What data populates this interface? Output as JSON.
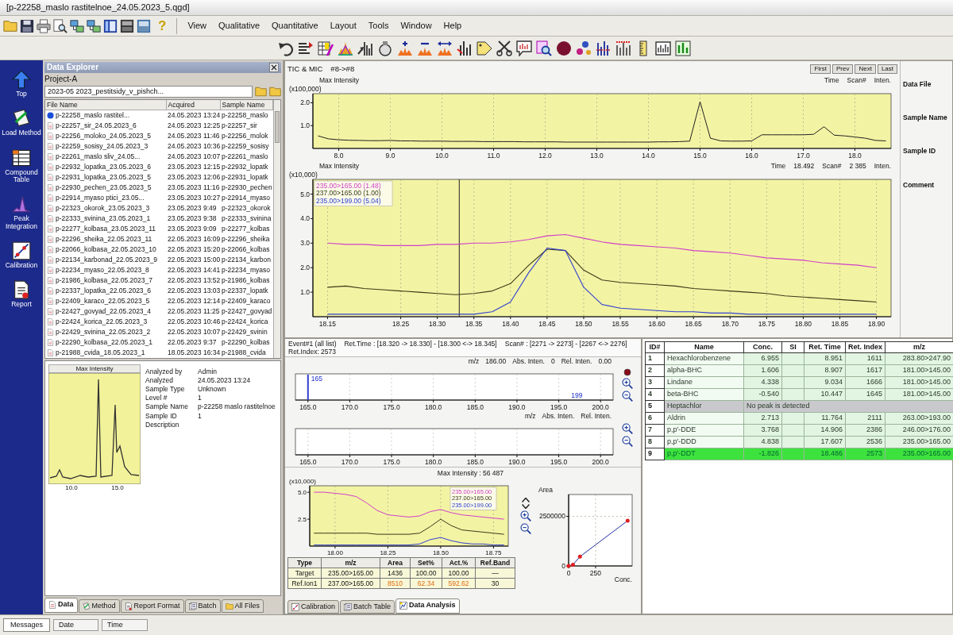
{
  "window": {
    "title": "[p-22258_maslo rastitelnoe_24.05.2023_5.qgd]"
  },
  "menu": [
    "View",
    "Qualitative",
    "Quantitative",
    "Layout",
    "Tools",
    "Window",
    "Help"
  ],
  "toolbar": {
    "help": "?"
  },
  "assistant_bar": {
    "items": [
      {
        "label": "Top",
        "kind": "top"
      },
      {
        "label": "Load Method",
        "kind": "method"
      },
      {
        "label": "Compound Table",
        "kind": "table"
      },
      {
        "label": "Peak Integration",
        "kind": "integration"
      },
      {
        "label": "Calibration",
        "kind": "calibration"
      },
      {
        "label": "Report",
        "kind": "report"
      }
    ]
  },
  "data_explorer": {
    "title": "Data Explorer",
    "project": "Project-A",
    "path": "2023-05 2023_pestitsidy_v_pishch...",
    "columns": [
      "File Name",
      "Acquired",
      "Sample Name"
    ],
    "files": [
      {
        "name": "p-22258_maslo rastitel...",
        "acquired": "24.05.2023 13:24",
        "sample": "p-22258_maslo",
        "open": true
      },
      {
        "name": "p-22257_sir_24.05.2023_6",
        "acquired": "24.05.2023 12:25",
        "sample": "p-22257_sir",
        "open": false
      },
      {
        "name": "p-22256_moloko_24.05.2023_5",
        "acquired": "24.05.2023 11:46",
        "sample": "p-22256_molok",
        "open": false
      },
      {
        "name": "p-22259_sosisy_24.05.2023_3",
        "acquired": "24.05.2023 10:36",
        "sample": "p-22259_sosisy",
        "open": false
      },
      {
        "name": "p-22261_maslo sliv_24.05...",
        "acquired": "24.05.2023 10:07",
        "sample": "p-22261_maslo",
        "open": false
      },
      {
        "name": "p-22932_lopatka_23.05.2023_6",
        "acquired": "23.05.2023 12:15",
        "sample": "p-22932_lopatk",
        "open": false
      },
      {
        "name": "p-22931_lopatka_23.05.2023_5",
        "acquired": "23.05.2023 12:06",
        "sample": "p-22931_lopatk",
        "open": false
      },
      {
        "name": "p-22930_pechen_23.05.2023_5",
        "acquired": "23.05.2023 11:16",
        "sample": "p-22930_pechen",
        "open": false
      },
      {
        "name": "p-22914_myaso ptici_23.05...",
        "acquired": "23.05.2023 10:27",
        "sample": "p-22914_myaso",
        "open": false
      },
      {
        "name": "p-22323_okorok_23.05.2023_3",
        "acquired": "23.05.2023 9:49",
        "sample": "p-22323_okorok",
        "open": false
      },
      {
        "name": "p-22333_svinina_23.05.2023_1",
        "acquired": "23.05.2023 9:38",
        "sample": "p-22333_svinina",
        "open": false
      },
      {
        "name": "p-22277_kolbasa_23.05.2023_11",
        "acquired": "23.05.2023 9:09",
        "sample": "p-22277_kolbas",
        "open": false
      },
      {
        "name": "p-22296_sheika_22.05.2023_11",
        "acquired": "22.05.2023 16:09",
        "sample": "p-22296_sheika",
        "open": false
      },
      {
        "name": "p-22066_kolbasa_22.05.2023_10",
        "acquired": "22.05.2023 15:20",
        "sample": "p-22066_kolbas",
        "open": false
      },
      {
        "name": "p-22134_karbonad_22.05.2023_9",
        "acquired": "22.05.2023 15:00",
        "sample": "p-22134_karbon",
        "open": false
      },
      {
        "name": "p-22234_myaso_22.05.2023_8",
        "acquired": "22.05.2023 14:41",
        "sample": "p-22234_myaso",
        "open": false
      },
      {
        "name": "p-21986_kolbasa_22.05.2023_7",
        "acquired": "22.05.2023 13:52",
        "sample": "p-21986_kolbas",
        "open": false
      },
      {
        "name": "p-22337_lopatka_22.05.2023_6",
        "acquired": "22.05.2023 13:03",
        "sample": "p-22337_lopatk",
        "open": false
      },
      {
        "name": "p-22409_karaco_22.05.2023_5",
        "acquired": "22.05.2023 12:14",
        "sample": "p-22409_karaco",
        "open": false
      },
      {
        "name": "p-22427_govyad_22.05.2023_4",
        "acquired": "22.05.2023 11:25",
        "sample": "p-22427_govyad",
        "open": false
      },
      {
        "name": "p-22424_korica_22.05.2023_3",
        "acquired": "22.05.2023 10:46",
        "sample": "p-22424_korica",
        "open": false
      },
      {
        "name": "p-22429_svinina_22.05.2023_2",
        "acquired": "22.05.2023 10:07",
        "sample": "p-22429_svinin",
        "open": false
      },
      {
        "name": "p-22290_kolbasa_22.05.2023_1",
        "acquired": "22.05.2023 9:37",
        "sample": "p-22290_kolbas",
        "open": false
      },
      {
        "name": "p-21988_cvida_18.05.2023_1",
        "acquired": "18.05.2023 16:34",
        "sample": "p-21988_cvida",
        "open": false
      }
    ],
    "preview": {
      "header": "Max Intensity",
      "x_labels": [
        "10.0",
        "15.0"
      ]
    },
    "info": [
      {
        "label": "Analyzed by",
        "value": "Admin"
      },
      {
        "label": "Analyzed",
        "value": "24.05.2023 13:24"
      },
      {
        "label": "Sample Type",
        "value": "Unknown"
      },
      {
        "label": "Level #",
        "value": "1"
      },
      {
        "label": "Sample Name",
        "value": "p-22258 maslo rastitelnoe"
      },
      {
        "label": "Sample ID",
        "value": "1"
      },
      {
        "label": "Description"
      }
    ],
    "tabs": [
      {
        "label": "Data",
        "kind": "data",
        "selected": true
      },
      {
        "label": "Method",
        "kind": "method",
        "selected": false
      },
      {
        "label": "Report Format",
        "kind": "report",
        "selected": false
      },
      {
        "label": "Batch",
        "kind": "batch",
        "selected": false
      },
      {
        "label": "All Files",
        "kind": "files",
        "selected": false
      }
    ]
  },
  "chromatogram": {
    "title": "TIC & MIC",
    "event": "#8->#8",
    "nav": [
      "First",
      "Prev",
      "Next",
      "Last"
    ],
    "tic": {
      "readout": [
        "Time",
        "Scan#",
        "Inten."
      ],
      "max_label": "Max Intensity",
      "chart_data": {
        "type": "line",
        "ylabel": "(x100,000)",
        "grid": true,
        "x": [
          7.6,
          7.8,
          8.0,
          8.2,
          8.4,
          8.6,
          8.8,
          9.0,
          9.2,
          9.4,
          9.6,
          9.8,
          10.0,
          10.2,
          10.4,
          10.6,
          10.8,
          11.0,
          11.2,
          11.4,
          11.6,
          11.8,
          12.0,
          12.2,
          12.4,
          12.6,
          12.8,
          13.0,
          13.2,
          13.4,
          13.6,
          13.8,
          14.0,
          14.2,
          14.4,
          14.6,
          14.8,
          15.0,
          15.2,
          15.4,
          15.6,
          15.8,
          16.0,
          16.2,
          16.4,
          16.6,
          16.8,
          17.0,
          17.2,
          17.4,
          17.6,
          17.8,
          18.0,
          18.2,
          18.4,
          18.6
        ],
        "series": [
          {
            "color": "#222222",
            "values": [
              0.55,
              0.42,
              0.38,
              0.36,
              0.35,
              0.34,
              0.34,
              0.35,
              0.33,
              0.33,
              0.32,
              0.32,
              0.32,
              0.31,
              0.31,
              0.31,
              0.3,
              0.3,
              0.3,
              0.3,
              0.29,
              0.29,
              0.29,
              0.29,
              0.28,
              0.28,
              0.28,
              0.28,
              0.28,
              0.28,
              0.28,
              0.28,
              0.28,
              0.29,
              0.29,
              0.3,
              0.32,
              2.05,
              0.45,
              0.33,
              0.32,
              0.32,
              0.33,
              0.6,
              0.6,
              0.6,
              0.6,
              0.6,
              0.62,
              0.95,
              0.58,
              0.55,
              0.5,
              0.45,
              0.35,
              0.33
            ]
          }
        ],
        "xlim": [
          7.5,
          18.7
        ],
        "ylim": [
          0,
          2.4
        ],
        "xticks": [
          {
            "value": 8,
            "label": "8.0"
          },
          {
            "value": 9,
            "label": "9.0"
          },
          {
            "value": 10,
            "label": "10.0"
          },
          {
            "value": 11,
            "label": "11.0"
          },
          {
            "value": 12,
            "label": "12.0"
          },
          {
            "value": 13,
            "label": "13.0"
          },
          {
            "value": 14,
            "label": "14.0"
          },
          {
            "value": 15,
            "label": "15.0"
          },
          {
            "value": 16,
            "label": "16.0"
          },
          {
            "value": 17,
            "label": "17.0"
          },
          {
            "value": 18,
            "label": "18.0"
          }
        ],
        "yticks": [
          {
            "value": 1,
            "label": "1.0"
          },
          {
            "value": 2,
            "label": "2.0"
          }
        ]
      }
    },
    "mic": {
      "readout": [
        "Time",
        "18.492",
        "Scan#",
        "2 385",
        "Inten."
      ],
      "max_label": "Max Intensity",
      "chart_data": {
        "type": "line",
        "ylabel": "(x10,000)",
        "grid": true,
        "x": [
          18.15,
          18.175,
          18.2,
          18.225,
          18.25,
          18.275,
          18.3,
          18.325,
          18.35,
          18.375,
          18.4,
          18.425,
          18.45,
          18.475,
          18.5,
          18.525,
          18.55,
          18.575,
          18.6,
          18.625,
          18.65,
          18.675,
          18.7,
          18.725,
          18.75,
          18.775,
          18.8,
          18.825,
          18.85,
          18.875,
          18.9
        ],
        "series": [
          {
            "name": "235.00>165.00 (1.48)",
            "color": "#d040c8",
            "values": [
              3.0,
              2.95,
              2.95,
              2.9,
              2.9,
              2.9,
              2.95,
              2.95,
              3.0,
              3.0,
              3.05,
              3.15,
              3.3,
              3.35,
              3.2,
              3.05,
              2.95,
              2.9,
              2.85,
              2.8,
              2.7,
              2.65,
              2.6,
              2.5,
              2.4,
              2.35,
              2.3,
              2.2,
              2.15,
              2.1,
              2.0
            ]
          },
          {
            "name": "237.00>165.00 (1.00)",
            "color": "#3a3a1a",
            "values": [
              1.2,
              1.25,
              1.15,
              1.1,
              1.05,
              1.0,
              0.95,
              0.9,
              0.95,
              1.05,
              1.35,
              2.1,
              2.75,
              2.7,
              1.9,
              1.5,
              1.4,
              1.35,
              1.3,
              1.25,
              1.15,
              1.1,
              1.05,
              1.0,
              0.95,
              0.85,
              0.8,
              0.75,
              0.7,
              0.65,
              0.6
            ]
          },
          {
            "name": "235.00>199.00 (5.04)",
            "color": "#3040d0",
            "values": [
              0.1,
              0.1,
              0.1,
              0.1,
              0.1,
              0.1,
              0.1,
              0.1,
              0.1,
              0.2,
              0.6,
              1.8,
              2.8,
              2.7,
              1.2,
              0.5,
              0.35,
              0.3,
              0.25,
              0.2,
              0.2,
              0.15,
              0.15,
              0.1,
              0.1,
              0.1,
              0.1,
              0.1,
              0.1,
              0.1,
              0.1
            ]
          }
        ],
        "xlim": [
          18.13,
          18.92
        ],
        "ylim": [
          0,
          5.6
        ],
        "xticks": [
          {
            "value": 18.15,
            "label": "18.15"
          },
          {
            "value": 18.25,
            "label": "18.25"
          },
          {
            "value": 18.3,
            "label": "18.30"
          },
          {
            "value": 18.35,
            "label": "18.35"
          },
          {
            "value": 18.4,
            "label": "18.40"
          },
          {
            "value": 18.45,
            "label": "18.45"
          },
          {
            "value": 18.5,
            "label": "18.50"
          },
          {
            "value": 18.55,
            "label": "18.55"
          },
          {
            "value": 18.6,
            "label": "18.60"
          },
          {
            "value": 18.65,
            "label": "18.65"
          },
          {
            "value": 18.7,
            "label": "18.70"
          },
          {
            "value": 18.75,
            "label": "18.75"
          },
          {
            "value": 18.8,
            "label": "18.80"
          },
          {
            "value": 18.85,
            "label": "18.85"
          },
          {
            "value": 18.9,
            "label": "18.90"
          }
        ],
        "yticks": [
          {
            "value": 1,
            "label": "1.0"
          },
          {
            "value": 2,
            "label": "2.0"
          },
          {
            "value": 3,
            "label": "3.0"
          },
          {
            "value": 4,
            "label": "4.0"
          },
          {
            "value": 5,
            "label": "5.0"
          }
        ],
        "ref_lines": [
          {
            "axis": "x",
            "value": 18.33
          }
        ]
      }
    }
  },
  "side_info": [
    "Data File",
    "Sample Name",
    "Sample ID",
    "Comment"
  ],
  "spectrum": {
    "header": [
      "Event#1 (all list)",
      "Ret.Time : [18.320 -> 18.330] - [18.300 <-> 18.345]",
      "Scan# : [2271 -> 2273] - [2267 <-> 2276]",
      "Ret.Index: 2573"
    ],
    "panels": [
      {
        "readout": [
          "m/z",
          "186.00",
          "Abs. Inten.",
          "0",
          "Rel. Inten.",
          "0.00"
        ],
        "axis_labels": [
          "165.0",
          "170.0",
          "175.0",
          "180.0",
          "185.0",
          "190.0",
          "195.0",
          "200.0"
        ],
        "peak_labels": [
          "165",
          "199"
        ]
      },
      {
        "readout": [
          "m/z",
          "Abs. Inten.",
          "Rel. Inten."
        ],
        "axis_labels": [
          "165.0",
          "170.0",
          "175.0",
          "180.0",
          "185.0",
          "190.0",
          "195.0",
          "200.0"
        ]
      }
    ]
  },
  "ion_view": {
    "max_label": "Max Intensity : 56 487",
    "chart_data": {
      "type": "line",
      "ylabel": "(x10,000)",
      "grid": true,
      "x": [
        17.9,
        17.95,
        18.0,
        18.05,
        18.1,
        18.15,
        18.2,
        18.25,
        18.3,
        18.35,
        18.4,
        18.45,
        18.5,
        18.55,
        18.6,
        18.65,
        18.7,
        18.75,
        18.8
      ],
      "series": [
        {
          "name": "235.00>165.00",
          "color": "#d040c8",
          "values": [
            5.0,
            5.0,
            4.9,
            4.8,
            4.6,
            4.0,
            3.3,
            2.9,
            2.8,
            2.7,
            2.8,
            3.2,
            3.4,
            3.1,
            2.9,
            2.8,
            2.7,
            2.6,
            2.5
          ]
        },
        {
          "name": "237.00>165.00",
          "color": "#3a3a1a",
          "values": [
            1.2,
            1.2,
            1.2,
            1.2,
            1.2,
            1.2,
            1.1,
            1.1,
            1.1,
            1.1,
            1.2,
            1.8,
            2.5,
            1.9,
            1.5,
            1.4,
            1.3,
            1.2,
            1.1
          ]
        },
        {
          "name": "235.00>199.00",
          "color": "#3040d0",
          "values": [
            0.1,
            0.1,
            0.1,
            0.1,
            0.1,
            0.1,
            0.1,
            0.1,
            0.1,
            0.1,
            0.2,
            0.6,
            0.8,
            0.5,
            0.3,
            0.2,
            0.2,
            0.1,
            0.1
          ]
        }
      ],
      "xlim": [
        17.88,
        18.82
      ],
      "ylim": [
        0,
        5.6
      ],
      "xticks": [
        {
          "value": 18,
          "label": "18.00"
        },
        {
          "value": 18.25,
          "label": "18.25"
        },
        {
          "value": 18.5,
          "label": "18.50"
        },
        {
          "value": 18.75,
          "label": "18.75"
        }
      ],
      "yticks": [
        {
          "value": 2.5,
          "label": "2.5"
        },
        {
          "value": 5,
          "label": "5.0"
        }
      ]
    },
    "columns": [
      "Type",
      "m/z",
      "Area",
      "Set%",
      "Act.%",
      "Ref.Band"
    ],
    "rows": [
      {
        "cells": [
          "Target",
          "235.00>165.00",
          "1436",
          "100.00",
          "100.00",
          "—"
        ],
        "out_of_band": false
      },
      {
        "cells": [
          "Ref.Ion1",
          "237.00>165.00",
          "8510",
          "62.34",
          "592.62",
          "30"
        ],
        "out_of_band": true
      }
    ]
  },
  "calibration": {
    "chart_data": {
      "type": "line",
      "grid": true,
      "xlabel": "Conc.",
      "ylabel": "Area",
      "x": [
        0,
        40,
        105,
        548
      ],
      "series": [
        {
          "color": "#2030a0",
          "values": [
            0,
            60000,
            470000,
            2280000
          ]
        }
      ],
      "xlim": [
        0,
        590
      ],
      "ylim": [
        0,
        3600000
      ],
      "xticks": [
        {
          "value": 0,
          "label": "0"
        },
        {
          "value": 250,
          "label": "250"
        }
      ],
      "yticks": [
        {
          "value": 0,
          "label": "0"
        },
        {
          "value": 2500000,
          "label": "2500000"
        }
      ]
    }
  },
  "bottom_tabs": [
    {
      "label": "Calibration",
      "kind": "calibration",
      "selected": false
    },
    {
      "label": "Batch Table",
      "kind": "batch",
      "selected": false
    },
    {
      "label": "Data Analysis",
      "kind": "analysis",
      "selected": true
    }
  ],
  "compound_table": {
    "columns": [
      "ID#",
      "Name",
      "Conc.",
      "SI",
      "Ret. Time",
      "Ret. Index",
      "m/z"
    ],
    "rows": [
      {
        "id": "1",
        "name": "Hexachlorobenzene",
        "detected": true,
        "conc": "6.955",
        "ret_time": "8.951",
        "ret_index": "1611",
        "mz": "283.80>247.90",
        "selected": false
      },
      {
        "id": "2",
        "name": "alpha-BHC",
        "detected": true,
        "conc": "1.606",
        "ret_time": "8.907",
        "ret_index": "1617",
        "mz": "181.00>145.00",
        "selected": false
      },
      {
        "id": "3",
        "name": "Lindane",
        "detected": true,
        "conc": "4.338",
        "ret_time": "9.034",
        "ret_index": "1666",
        "mz": "181.00>145.00",
        "selected": false
      },
      {
        "id": "4",
        "name": "beta-BHC",
        "detected": true,
        "conc": "-0.540",
        "ret_time": "10.447",
        "ret_index": "1645",
        "mz": "181.00>145.00",
        "selected": false
      },
      {
        "id": "5",
        "name": "Heptachlor",
        "detected": false,
        "message": "No peak is detected",
        "selected": false
      },
      {
        "id": "6",
        "name": "Aldrin",
        "detected": true,
        "conc": "2.713",
        "ret_time": "11.764",
        "ret_index": "2111",
        "mz": "263.00>193.00",
        "selected": false
      },
      {
        "id": "7",
        "name": "p,p'-DDE",
        "detected": true,
        "conc": "3.768",
        "ret_time": "14.906",
        "ret_index": "2386",
        "mz": "246.00>176.00",
        "selected": false
      },
      {
        "id": "8",
        "name": "p,p'-DDD",
        "detected": true,
        "conc": "4.838",
        "ret_time": "17.607",
        "ret_index": "2536",
        "mz": "235.00>165.00",
        "selected": false
      },
      {
        "id": "9",
        "name": "p,p'-DDT",
        "detected": true,
        "conc": "-1.826",
        "ret_time": "18.486",
        "ret_index": "2573",
        "mz": "235.00>165.00",
        "selected": true
      }
    ]
  },
  "messages": {
    "title": "Messages",
    "columns": [
      "Date",
      "Time"
    ]
  }
}
